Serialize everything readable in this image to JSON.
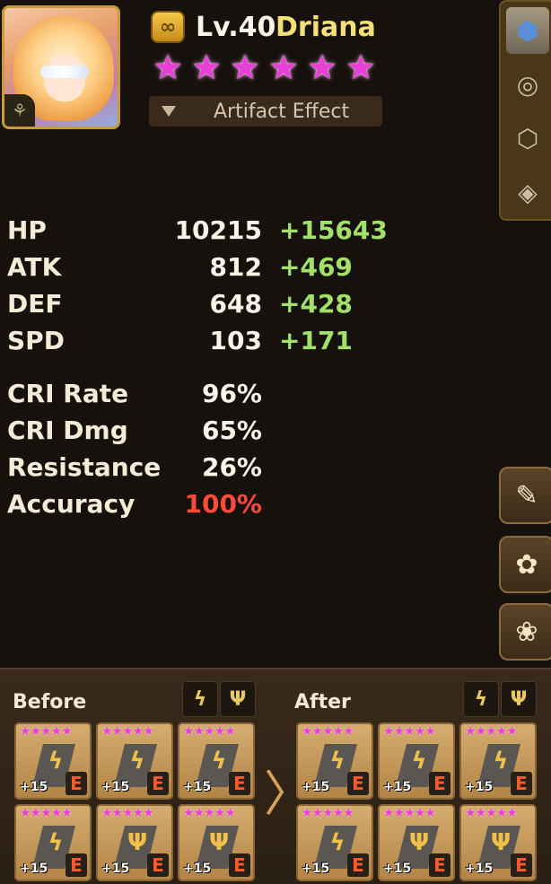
{
  "monster": {
    "level": "Lv.40",
    "name": "Driana",
    "stars": [
      "★",
      "★",
      "★",
      "★",
      "★",
      "★"
    ],
    "artifact_label": "Artifact Effect",
    "element_icon": "⚘"
  },
  "stats": [
    {
      "label": "HP",
      "base": "10215",
      "bonus": "+15643"
    },
    {
      "label": "ATK",
      "base": "812",
      "bonus": "+469"
    },
    {
      "label": "DEF",
      "base": "648",
      "bonus": "+428"
    },
    {
      "label": "SPD",
      "base": "103",
      "bonus": "+171"
    }
  ],
  "secondary": [
    {
      "label": "CRI Rate",
      "value": "96%"
    },
    {
      "label": "CRI Dmg",
      "value": "65%"
    },
    {
      "label": "Resistance",
      "value": "26%"
    },
    {
      "label": "Accuracy",
      "value": "100%",
      "color": "#ff4a3a"
    }
  ],
  "tabs": {
    "icons": [
      "rune-tab-icon",
      "artifact-slot-icon",
      "engrave-icon",
      "collection-icon"
    ]
  },
  "panel": {
    "before_label": "Before",
    "after_label": "After",
    "set_glyphs": [
      "ϟ",
      "Ψ"
    ],
    "arrow": "〉",
    "rune_stars": "★★★★★",
    "rune_level": "+15",
    "rune_grade": "E",
    "before_glyphs": [
      "ϟ",
      "ϟ",
      "ϟ",
      "ϟ",
      "Ψ",
      "Ψ"
    ],
    "after_glyphs": [
      "ϟ",
      "ϟ",
      "ϟ",
      "ϟ",
      "Ψ",
      "Ψ"
    ]
  },
  "colors": {
    "accent_gold": "#c99a37",
    "star_pink": "#e83fd6",
    "bonus_green": "#a2e06a",
    "warn_red": "#ff4a3a"
  }
}
